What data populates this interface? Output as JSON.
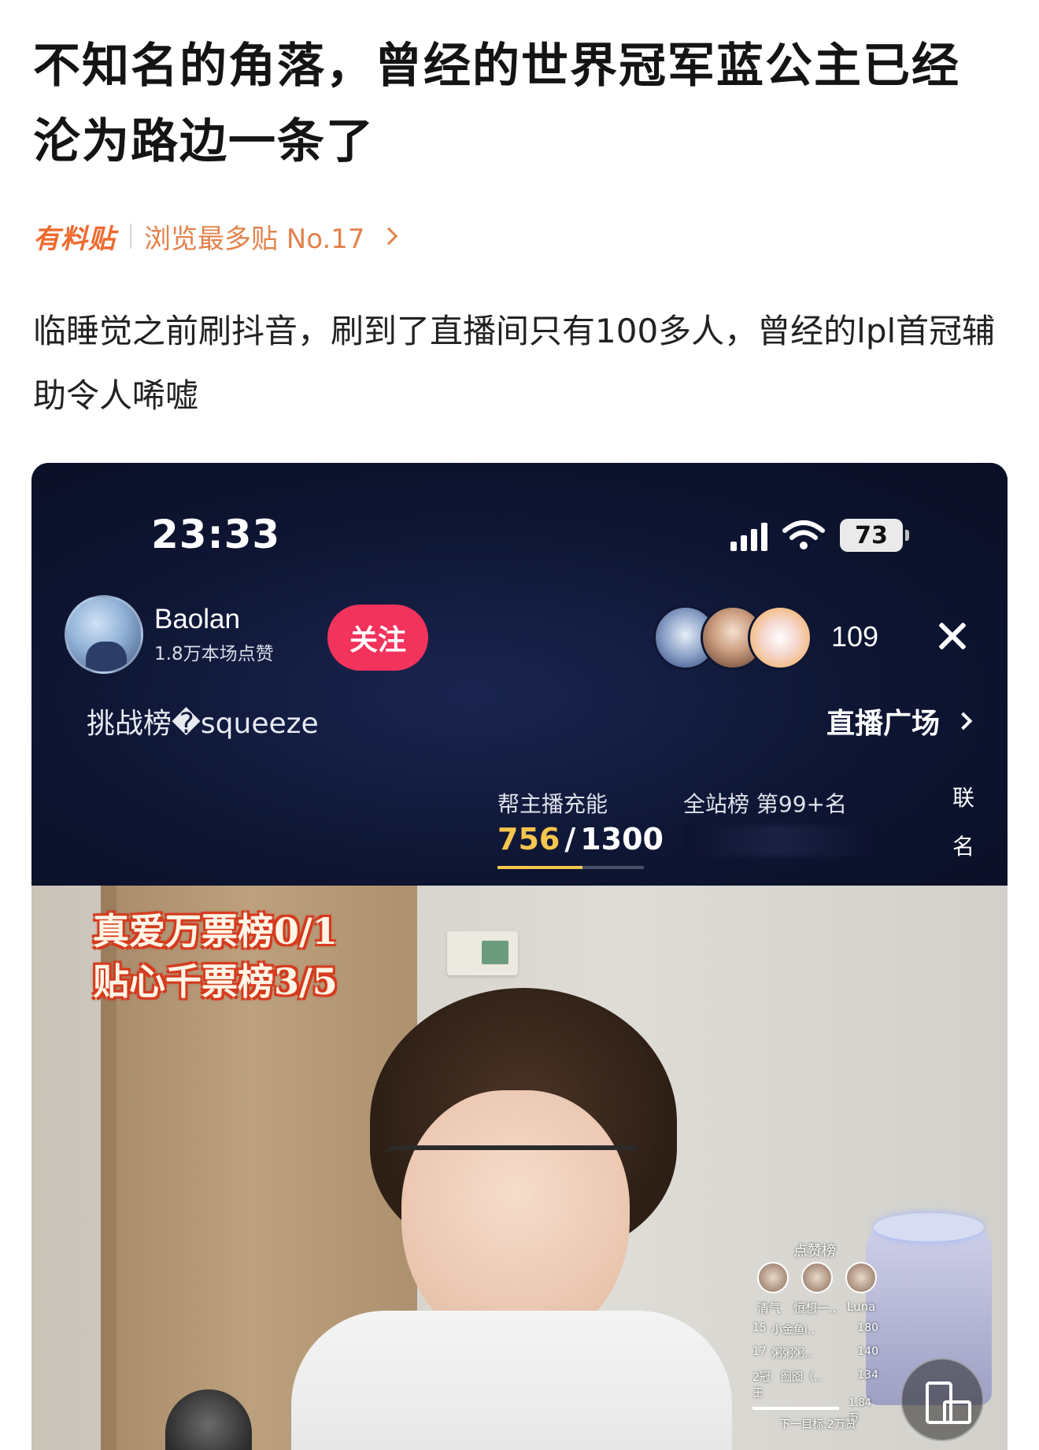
{
  "post": {
    "title": "不知名的角落，曾经的世界冠军蓝公主已经沦为路边一条了",
    "brand": "有料贴",
    "rank": "浏览最多贴 No.17",
    "body": "临睡觉之前刷抖音，刷到了直播间只有100多人，曾经的lpl首冠辅助令人唏嘘"
  },
  "screenshot": {
    "status_bar": {
      "time": "23:33",
      "battery": "73"
    },
    "streamer": {
      "name": "Baolan",
      "likes": "1.8万本场点赞",
      "follow_label": "关注"
    },
    "viewer_count": "109",
    "challenge_label": "挑战榜�squeeze",
    "plaza_label": "直播广场",
    "charge": {
      "label": "帮主播充能",
      "current": "756",
      "total": "1300",
      "progress": 0.58
    },
    "rank": {
      "label": "全站榜 第99+名"
    },
    "joint_1": "联",
    "joint_2": "名",
    "overlay": {
      "line1": "真爱万票榜0/1",
      "line2": "贴心千票榜3/5"
    },
    "likes_board": {
      "title": "点赞榜",
      "top3": [
        "清气",
        "恒想一..",
        "Luna"
      ],
      "rows": [
        {
          "rank": "15",
          "name": "小金鱼i..",
          "score": "180"
        },
        {
          "rank": "17",
          "name": "粥粥粥..",
          "score": "140"
        },
        {
          "rank": "2冠王",
          "name": "囫囵（..",
          "score": "134"
        }
      ],
      "progress_value": "1.84万",
      "goal": "下一目标:2万赞"
    }
  }
}
